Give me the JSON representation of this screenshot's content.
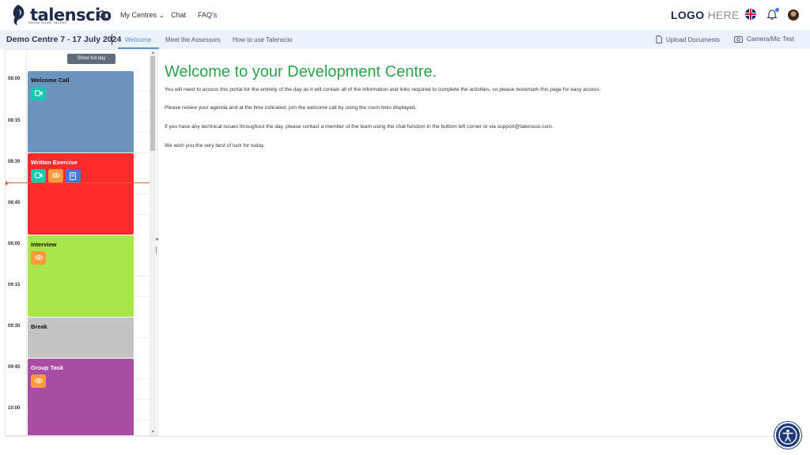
{
  "header": {
    "brand_name": "talenscio",
    "brand_tagline": "SHOW YOUR TALENT",
    "nav": [
      {
        "label": "My Centres ⌄"
      },
      {
        "label": "Chat"
      },
      {
        "label": "FAQ's"
      }
    ],
    "client_logo_bold": "LOGO",
    "client_logo_light": " HERE",
    "icons": [
      "search-icon",
      "uk-flag-icon",
      "bell-icon",
      "avatar"
    ]
  },
  "subnav": {
    "centre_title": "Demo Centre 7 - 17 July 2024",
    "tabs": [
      {
        "label": "Welcome",
        "active": true
      },
      {
        "label": "Meet the Assessors",
        "active": false
      },
      {
        "label": "How to use Talenscio",
        "active": false
      }
    ],
    "actions": [
      {
        "label": "Upload Documents",
        "icon": "document-icon"
      },
      {
        "label": "Camera/Mic Test",
        "icon": "camera-icon"
      }
    ]
  },
  "schedule": {
    "show_full_day": "Show full day",
    "times": [
      "08:00",
      "08:15",
      "08:30",
      "08:45",
      "09:00",
      "09:15",
      "09:30",
      "09:45",
      "10:00"
    ],
    "events": [
      {
        "title": "Welcome Call",
        "color": "#6b95bf",
        "start": "08:00",
        "end": "08:30",
        "actions": [
          "video-icon"
        ]
      },
      {
        "title": "Written Exercise",
        "color": "#ff2b2b",
        "start": "08:30",
        "end": "09:00",
        "actions": [
          "video-icon",
          "eye-icon",
          "document-edit-icon"
        ]
      },
      {
        "title": "Interview",
        "color": "#a8e64a",
        "start": "09:00",
        "end": "09:30",
        "actions": [
          "eye-icon"
        ]
      },
      {
        "title": "Break",
        "color": "#c4c4c4",
        "start": "09:30",
        "end": "09:45",
        "actions": []
      },
      {
        "title": "Group Task",
        "color": "#a84ca4",
        "start": "09:45",
        "end": "10:15",
        "actions": [
          "eye-icon"
        ]
      }
    ]
  },
  "main": {
    "heading": "Welcome to your Development Centre.",
    "paragraphs": [
      "You will need to access this portal for the entirety of the day as it will contain all of the information and links required to complete the activities, so please bookmark this page for easy access.",
      "Please review your agenda and at the time indicated, join the welcome call by using the room links displayed.",
      "If you have any technical issues throughout the day, please contact a member of the team using the chat function in the bottom left corner or via support@talenscio.com.",
      "We wish you the very best of luck for today."
    ]
  },
  "colors": {
    "heading_green": "#2aa54a",
    "tab_active": "#5b8fd6",
    "btn_teal": "#17c9b0",
    "btn_orange": "#ff9a3c",
    "btn_blue": "#3d7be0",
    "accessibility": "#1e3a78"
  }
}
